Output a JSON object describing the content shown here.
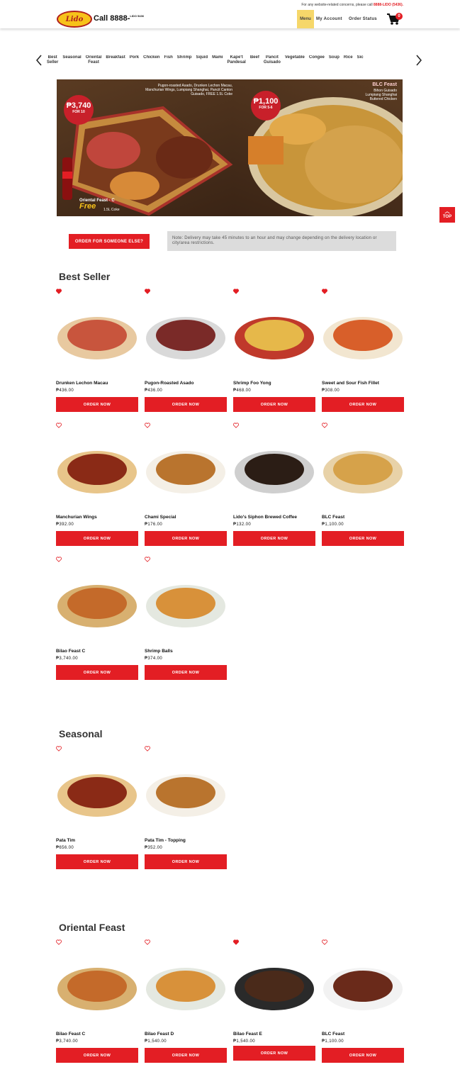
{
  "header": {
    "note_prefix": "For any website-related concerns, please call",
    "note_phone": "8888-LIDO (5436).",
    "logo_text": "Lido",
    "phone_main": "Call 8888-",
    "phone_small": "LIDO 5436",
    "nav": {
      "menu": "Menu",
      "account": "My Account",
      "order_status": "Order Status"
    },
    "cart_count": "0"
  },
  "categories": [
    "Best\nSeller",
    "Seasonal",
    "Oriental\nFeast",
    "Breakfast",
    "Pork",
    "Chicken",
    "Fish",
    "Shrimp",
    "Squid",
    "Mami",
    "Kape't\nPandesal",
    "Beef",
    "Pancit\nGuisado",
    "Vegetable",
    "Congee",
    "Soup",
    "Rice",
    "Sic"
  ],
  "banner": {
    "left_price": "₱3,740",
    "left_for": "FOR 10",
    "left_desc": "Pugon-roasted Asado, Drunken Lechon Macau, Manchurian Wings, Lumpiang Shanghai, Pancit Canton Guisado, FREE 1.5L Coke",
    "left_label": "Oriental Feast - C",
    "left_free": "Free",
    "left_coke": "1.5L Coke",
    "right_price": "₱1,100",
    "right_for": "FOR 5-6",
    "right_title": "BLC Feast",
    "right_desc": "Bihon Guisado\nLumpiang Shanghai\nButtered Chicken"
  },
  "top_button": "TOP",
  "someone_button": "ORDER FOR SOMEONE ELSE?",
  "delivery_note": "Note: Delivery may take 45 minutes to an hour and may change depending on the delivery location or city/area restrictions.",
  "order_label": "ORDER NOW",
  "sections": [
    {
      "title": "Best Seller",
      "items": [
        {
          "name": "Drunken Lechon Macau",
          "price": "₱436.00"
        },
        {
          "name": "Pugon-Roasted Asado",
          "price": "₱436.00"
        },
        {
          "name": "Shrimp Foo Yong",
          "price": "₱468.00"
        },
        {
          "name": "Sweet and Sour Fish Fillet",
          "price": "₱308.00"
        },
        {
          "name": "Manchurian Wings",
          "price": "₱392.00"
        },
        {
          "name": "Chami Special",
          "price": "₱176.00"
        },
        {
          "name": "Lido's Siphon Brewed Coffee",
          "price": "₱132.00"
        },
        {
          "name": "BLC Feast",
          "price": "₱1,100.00"
        },
        {
          "name": "Bilao Feast C",
          "price": "₱3,740.00"
        },
        {
          "name": "Shrimp Balls",
          "price": "₱374.00"
        }
      ]
    },
    {
      "title": "Seasonal",
      "items": [
        {
          "name": "Pata Tim",
          "price": "₱656.00"
        },
        {
          "name": "Pata Tim - Topping",
          "price": "₱352.00"
        }
      ]
    },
    {
      "title": "Oriental Feast",
      "items": [
        {
          "name": "Bilao Feast C",
          "price": "₱3,740.00"
        },
        {
          "name": "Bilao Feast D",
          "price": "₱1,540.00"
        },
        {
          "name": "Bilao Feast E",
          "price": "₱1,540.00"
        },
        {
          "name": "BLC Feast",
          "price": "₱1,100.00"
        }
      ]
    }
  ]
}
